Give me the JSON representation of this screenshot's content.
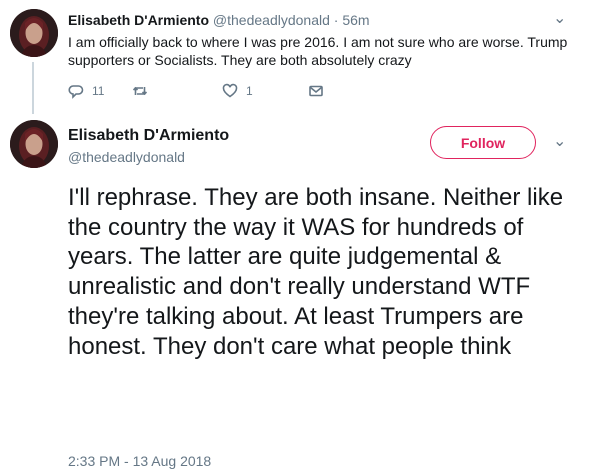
{
  "reply": {
    "name": "Elisabeth D'Armiento",
    "handle": "@thedeadlydonald",
    "time": "· 56m",
    "text": "I am officially back to where I was pre 2016. I am  not sure who are worse. Trump supporters or Socialists. They are both absolutely crazy",
    "reply_count": "11",
    "retweet_count": "",
    "like_count": "1"
  },
  "main_tweet": {
    "name": "Elisabeth D'Armiento",
    "handle": "@thedeadlydonald",
    "follow_label": "Follow",
    "text": "I'll rephrase. They are both insane. Neither like the country the way it WAS for hundreds of years. The latter are quite judgemental & unrealistic and don't really understand WTF they're talking about. At least Trumpers are honest. They don't care what people think",
    "timestamp": "2:33 PM - 13 Aug 2018"
  },
  "icons": {
    "reply": "reply-icon",
    "retweet": "retweet-icon",
    "like": "heart-icon",
    "dm": "envelope-icon",
    "menu": "chevron-down-icon"
  },
  "colors": {
    "follow_accent": "#e0245e",
    "secondary_text": "#657786",
    "primary_text": "#14171a"
  }
}
